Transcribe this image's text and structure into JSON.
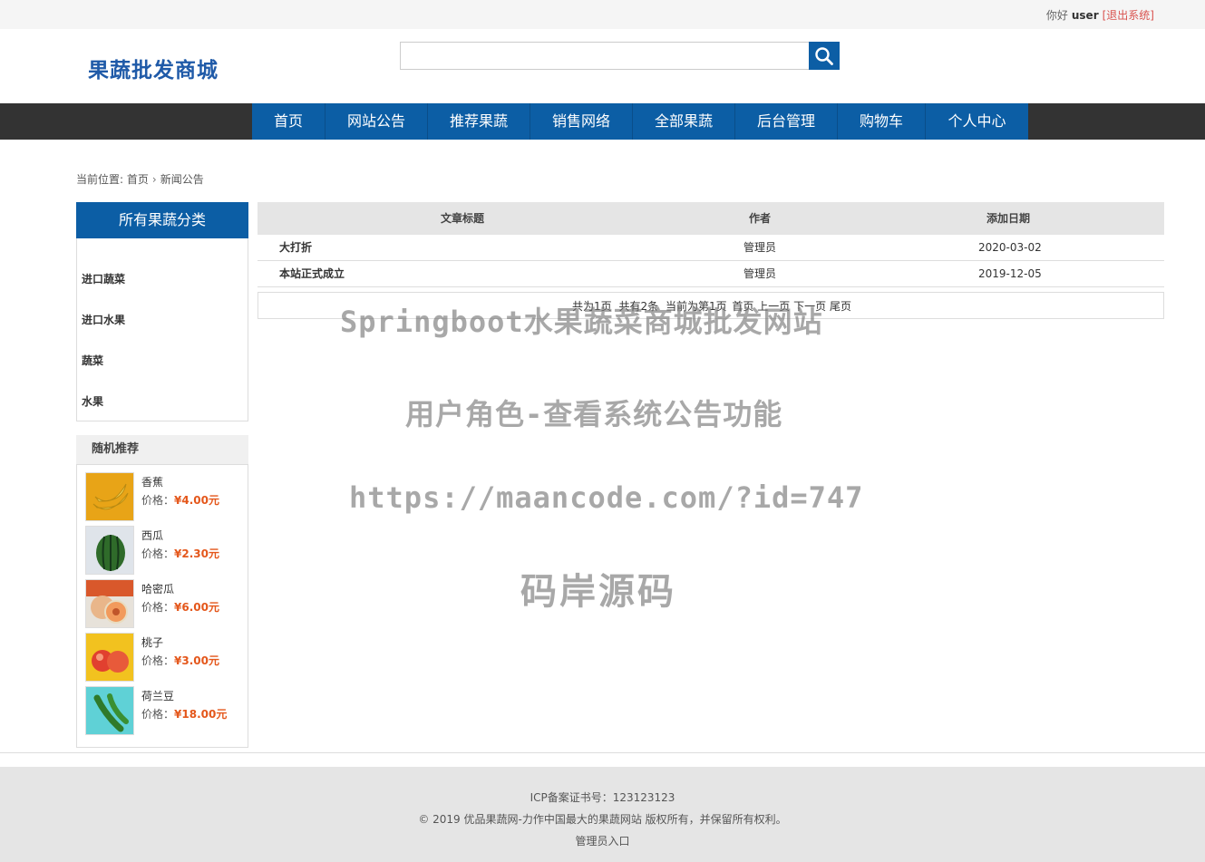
{
  "topbar": {
    "greeting": "你好",
    "username": "user",
    "logout": "[退出系统]"
  },
  "header": {
    "logo": "果蔬批发商城",
    "search_placeholder": ""
  },
  "nav": [
    "首页",
    "网站公告",
    "推荐果蔬",
    "销售网络",
    "全部果蔬",
    "后台管理",
    "购物车",
    "个人中心"
  ],
  "breadcrumb": {
    "prefix": "当前位置:",
    "home": "首页",
    "current": "新闻公告"
  },
  "categories": {
    "title": "所有果蔬分类",
    "items": [
      "进口蔬菜",
      "进口水果",
      "蔬菜",
      "水果"
    ]
  },
  "recommend": {
    "title": "随机推荐",
    "price_label": "价格：",
    "items": [
      {
        "name": "香蕉",
        "price": "¥4.00元"
      },
      {
        "name": "西瓜",
        "price": "¥2.30元"
      },
      {
        "name": "哈密瓜",
        "price": "¥6.00元"
      },
      {
        "name": "桃子",
        "price": "¥3.00元"
      },
      {
        "name": "荷兰豆",
        "price": "¥18.00元"
      }
    ]
  },
  "table": {
    "headers": [
      "文章标题",
      "作者",
      "添加日期"
    ],
    "rows": [
      [
        "大打折",
        "管理员",
        "2020-03-02"
      ],
      [
        "本站正式成立",
        "管理员",
        "2019-12-05"
      ]
    ]
  },
  "pager": {
    "total_pages": "共为1页",
    "total_items": "共有2条",
    "current": "当前为第1页",
    "first": "首页",
    "prev": "上一页",
    "next": "下一页",
    "last": "尾页"
  },
  "watermark": [
    "Springboot水果蔬菜商城批发网站",
    "用户角色-查看系统公告功能",
    "https://maancode.com/?id=747",
    "码岸源码"
  ],
  "footer": {
    "icp": "ICP备案证书号：123123123",
    "copyright": "© 2019 优品果蔬网-力作中国最大的果蔬网站 版权所有，并保留所有权利。",
    "admin": "管理员入口"
  },
  "colors": {
    "primary": "#0c5ea5",
    "navbar_bg": "#333333",
    "price": "#e4571b",
    "logout": "#d9534f"
  }
}
